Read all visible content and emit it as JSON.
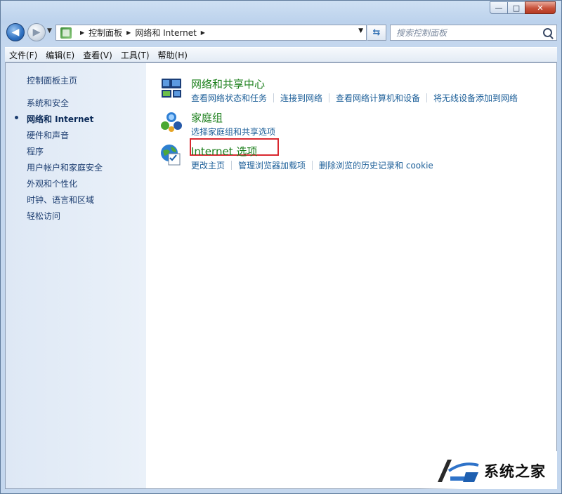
{
  "window": {
    "caption": {
      "minimize": "—",
      "maximize": "□",
      "close": "✕"
    }
  },
  "address_bar": {
    "breadcrumb": [
      "控制面板",
      "网络和 Internet"
    ],
    "search_placeholder": "搜索控制面板"
  },
  "menu": [
    "文件(F)",
    "编辑(E)",
    "查看(V)",
    "工具(T)",
    "帮助(H)"
  ],
  "sidebar": {
    "home": "控制面板主页",
    "items": [
      "系统和安全",
      "网络和 Internet",
      "硬件和声音",
      "程序",
      "用户帐户和家庭安全",
      "外观和个性化",
      "时钟、语言和区域",
      "轻松访问"
    ],
    "current": "网络和 Internet"
  },
  "categories": [
    {
      "title": "网络和共享中心",
      "icon": "network-sharing-icon",
      "links": [
        "查看网络状态和任务",
        "连接到网络",
        "查看网络计算机和设备",
        "将无线设备添加到网络"
      ]
    },
    {
      "title": "家庭组",
      "icon": "homegroup-icon",
      "links": [
        "选择家庭组和共享选项"
      ]
    },
    {
      "title": "Internet 选项",
      "icon": "internet-options-icon",
      "links": [
        "更改主页",
        "管理浏览器加载项",
        "删除浏览的历史记录和 cookie"
      ],
      "highlighted": true
    }
  ],
  "colors": {
    "category_title": "#1a7e1a",
    "link": "#1b5e98",
    "highlight_box": "#d9272e"
  },
  "watermark": {
    "text": "系统之家"
  }
}
